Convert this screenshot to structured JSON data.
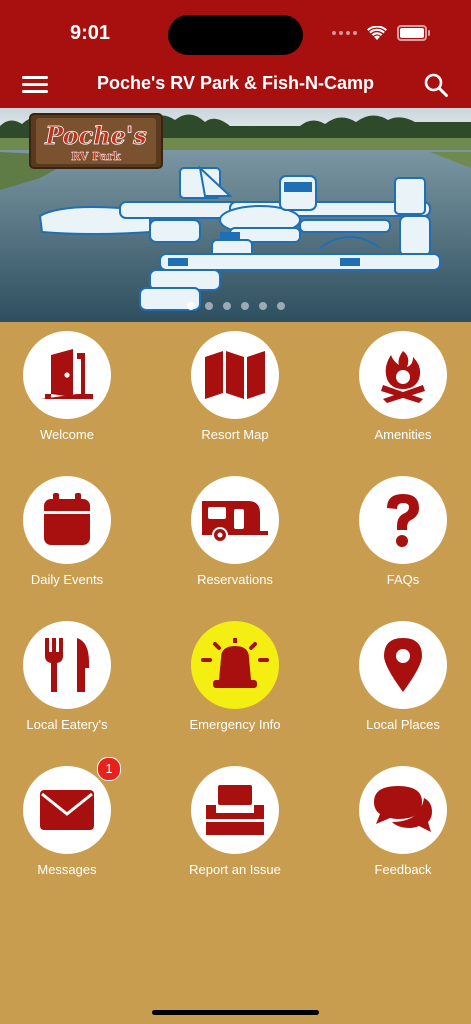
{
  "status": {
    "time": "9:01"
  },
  "header": {
    "title": "Poche's RV Park & Fish-N-Camp"
  },
  "hero": {
    "sign_title": "Poche's",
    "sign_subtitle": "RV Park",
    "slide_count": 6,
    "active_slide": 1
  },
  "tiles": [
    {
      "label": "Welcome",
      "icon": "door-icon"
    },
    {
      "label": "Resort Map",
      "icon": "map-icon"
    },
    {
      "label": "Amenities",
      "icon": "campfire-icon"
    },
    {
      "label": "Daily Events",
      "icon": "calendar-icon"
    },
    {
      "label": "Reservations",
      "icon": "camper-trailer-icon"
    },
    {
      "label": "FAQs",
      "icon": "question-icon"
    },
    {
      "label": "Local Eatery's",
      "icon": "utensils-icon"
    },
    {
      "label": "Emergency Info",
      "icon": "siren-icon"
    },
    {
      "label": "Local Places",
      "icon": "map-pin-icon"
    },
    {
      "label": "Messages",
      "icon": "envelope-icon",
      "badge": "1"
    },
    {
      "label": "Report an Issue",
      "icon": "inbox-tray-icon"
    },
    {
      "label": "Feedback",
      "icon": "chat-bubbles-icon"
    }
  ],
  "colors": {
    "brand_red": "#a8100f",
    "background": "#c99d50",
    "icon_red": "#a8100f",
    "emergency_yellow": "#f4ee12",
    "badge_red": "#e8211d"
  }
}
